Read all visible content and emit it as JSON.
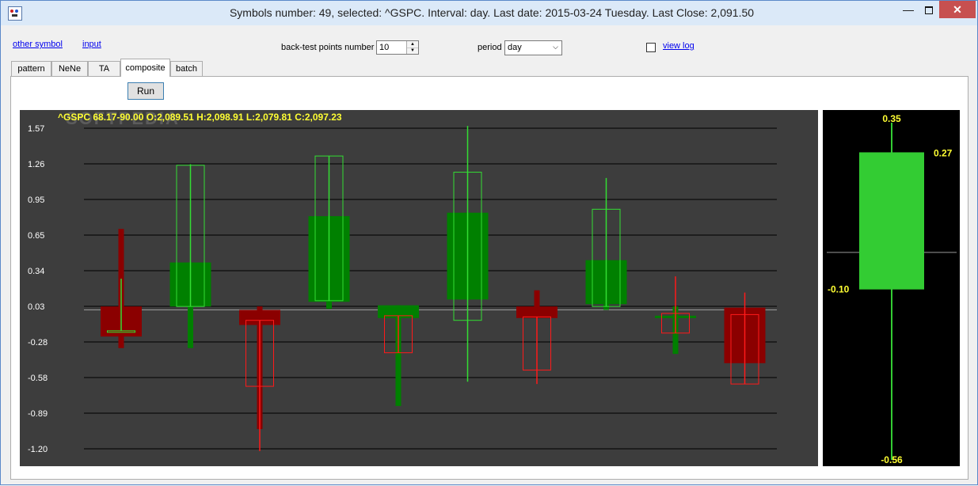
{
  "title_bar": {
    "title": "Symbols number: 49, selected:  ^GSPC. Interval: day.  Last date: 2015-03-24 Tuesday.  Last Close: 2,091.50",
    "minimize": "—",
    "close": "✕"
  },
  "toolbar": {
    "other_symbol": "other symbol",
    "input": "input",
    "backtest_label": "back-test points number",
    "backtest_value": "10",
    "period_label": "period",
    "period_value": "day",
    "view_log": "view log",
    "view_log_checked": false
  },
  "tabs": [
    {
      "label": "pattern"
    },
    {
      "label": "NeNe"
    },
    {
      "label": "TA"
    },
    {
      "label": "composite",
      "active": true
    },
    {
      "label": "batch"
    }
  ],
  "run_label": "Run",
  "colors": {
    "chart_bg": "#3d3d3d",
    "bull": "#008000",
    "bull_line": "#33dd33",
    "bear": "#8b0000",
    "bear_line": "#ff1a1a",
    "label": "#ffff33",
    "side_candle": "#33cc33"
  },
  "chart_data": [
    {
      "type": "candlestick",
      "header": "^GSPC  68.17-90.00   O:2,089.51   H:2,098.91   L:2,079.81   C:2,097.23",
      "watermark": "SOFTPEDIA",
      "y_ticks": [
        "1.57",
        "1.26",
        "0.95",
        "0.65",
        "0.34",
        "0.03",
        "-0.28",
        "-0.58",
        "-0.89",
        "-1.20"
      ],
      "ylim": [
        -1.2,
        1.57
      ],
      "grid": true,
      "reference_line": 0.0,
      "solid_candles": [
        {
          "open": 0.03,
          "close": -0.23,
          "high": 0.7,
          "low": -0.33
        },
        {
          "open": 0.03,
          "close": 0.41,
          "high": 0.41,
          "low": -0.33
        },
        {
          "open": 0.0,
          "close": -0.13,
          "high": 0.03,
          "low": -1.03
        },
        {
          "open": 0.07,
          "close": 0.81,
          "high": 0.81,
          "low": 0.01
        },
        {
          "open": -0.07,
          "close": 0.04,
          "high": 0.04,
          "low": -0.83
        },
        {
          "open": 0.09,
          "close": 0.84,
          "high": 0.84,
          "low": 0.09
        },
        {
          "open": 0.03,
          "close": -0.07,
          "high": 0.17,
          "low": -0.07
        },
        {
          "open": 0.05,
          "close": 0.43,
          "high": 0.43,
          "low": 0.0
        },
        {
          "open": -0.05,
          "close": -0.05,
          "high": 0.03,
          "low": -0.38
        },
        {
          "open": 0.02,
          "close": -0.46,
          "high": 0.02,
          "low": -0.46
        }
      ],
      "outline_candles": [
        {
          "open": -0.18,
          "close": -0.18,
          "high": 0.27,
          "low": -0.18
        },
        {
          "open": 0.03,
          "close": 1.25,
          "high": 1.26,
          "low": 0.03
        },
        {
          "open": -0.09,
          "close": -0.66,
          "high": -0.09,
          "low": -1.22
        },
        {
          "open": 0.08,
          "close": 1.33,
          "high": 1.33,
          "low": 0.08
        },
        {
          "open": -0.05,
          "close": -0.37,
          "high": -0.05,
          "low": -0.37
        },
        {
          "open": -0.09,
          "close": 1.19,
          "high": 1.59,
          "low": -0.62
        },
        {
          "open": -0.06,
          "close": -0.52,
          "high": -0.06,
          "low": -0.64
        },
        {
          "open": 0.03,
          "close": 0.87,
          "high": 1.14,
          "low": 0.03
        },
        {
          "open": -0.03,
          "close": -0.2,
          "high": 0.29,
          "low": -0.2
        },
        {
          "open": -0.04,
          "close": -0.64,
          "high": 0.15,
          "low": -0.64
        }
      ]
    },
    {
      "type": "candlestick",
      "high_label": "0.35",
      "close_label": "0.27",
      "open_label": "-0.10",
      "low_label": "-0.56",
      "candle": {
        "high": 0.35,
        "close": 0.27,
        "open": -0.1,
        "low": -0.56
      },
      "reference_line": 0.0
    }
  ]
}
